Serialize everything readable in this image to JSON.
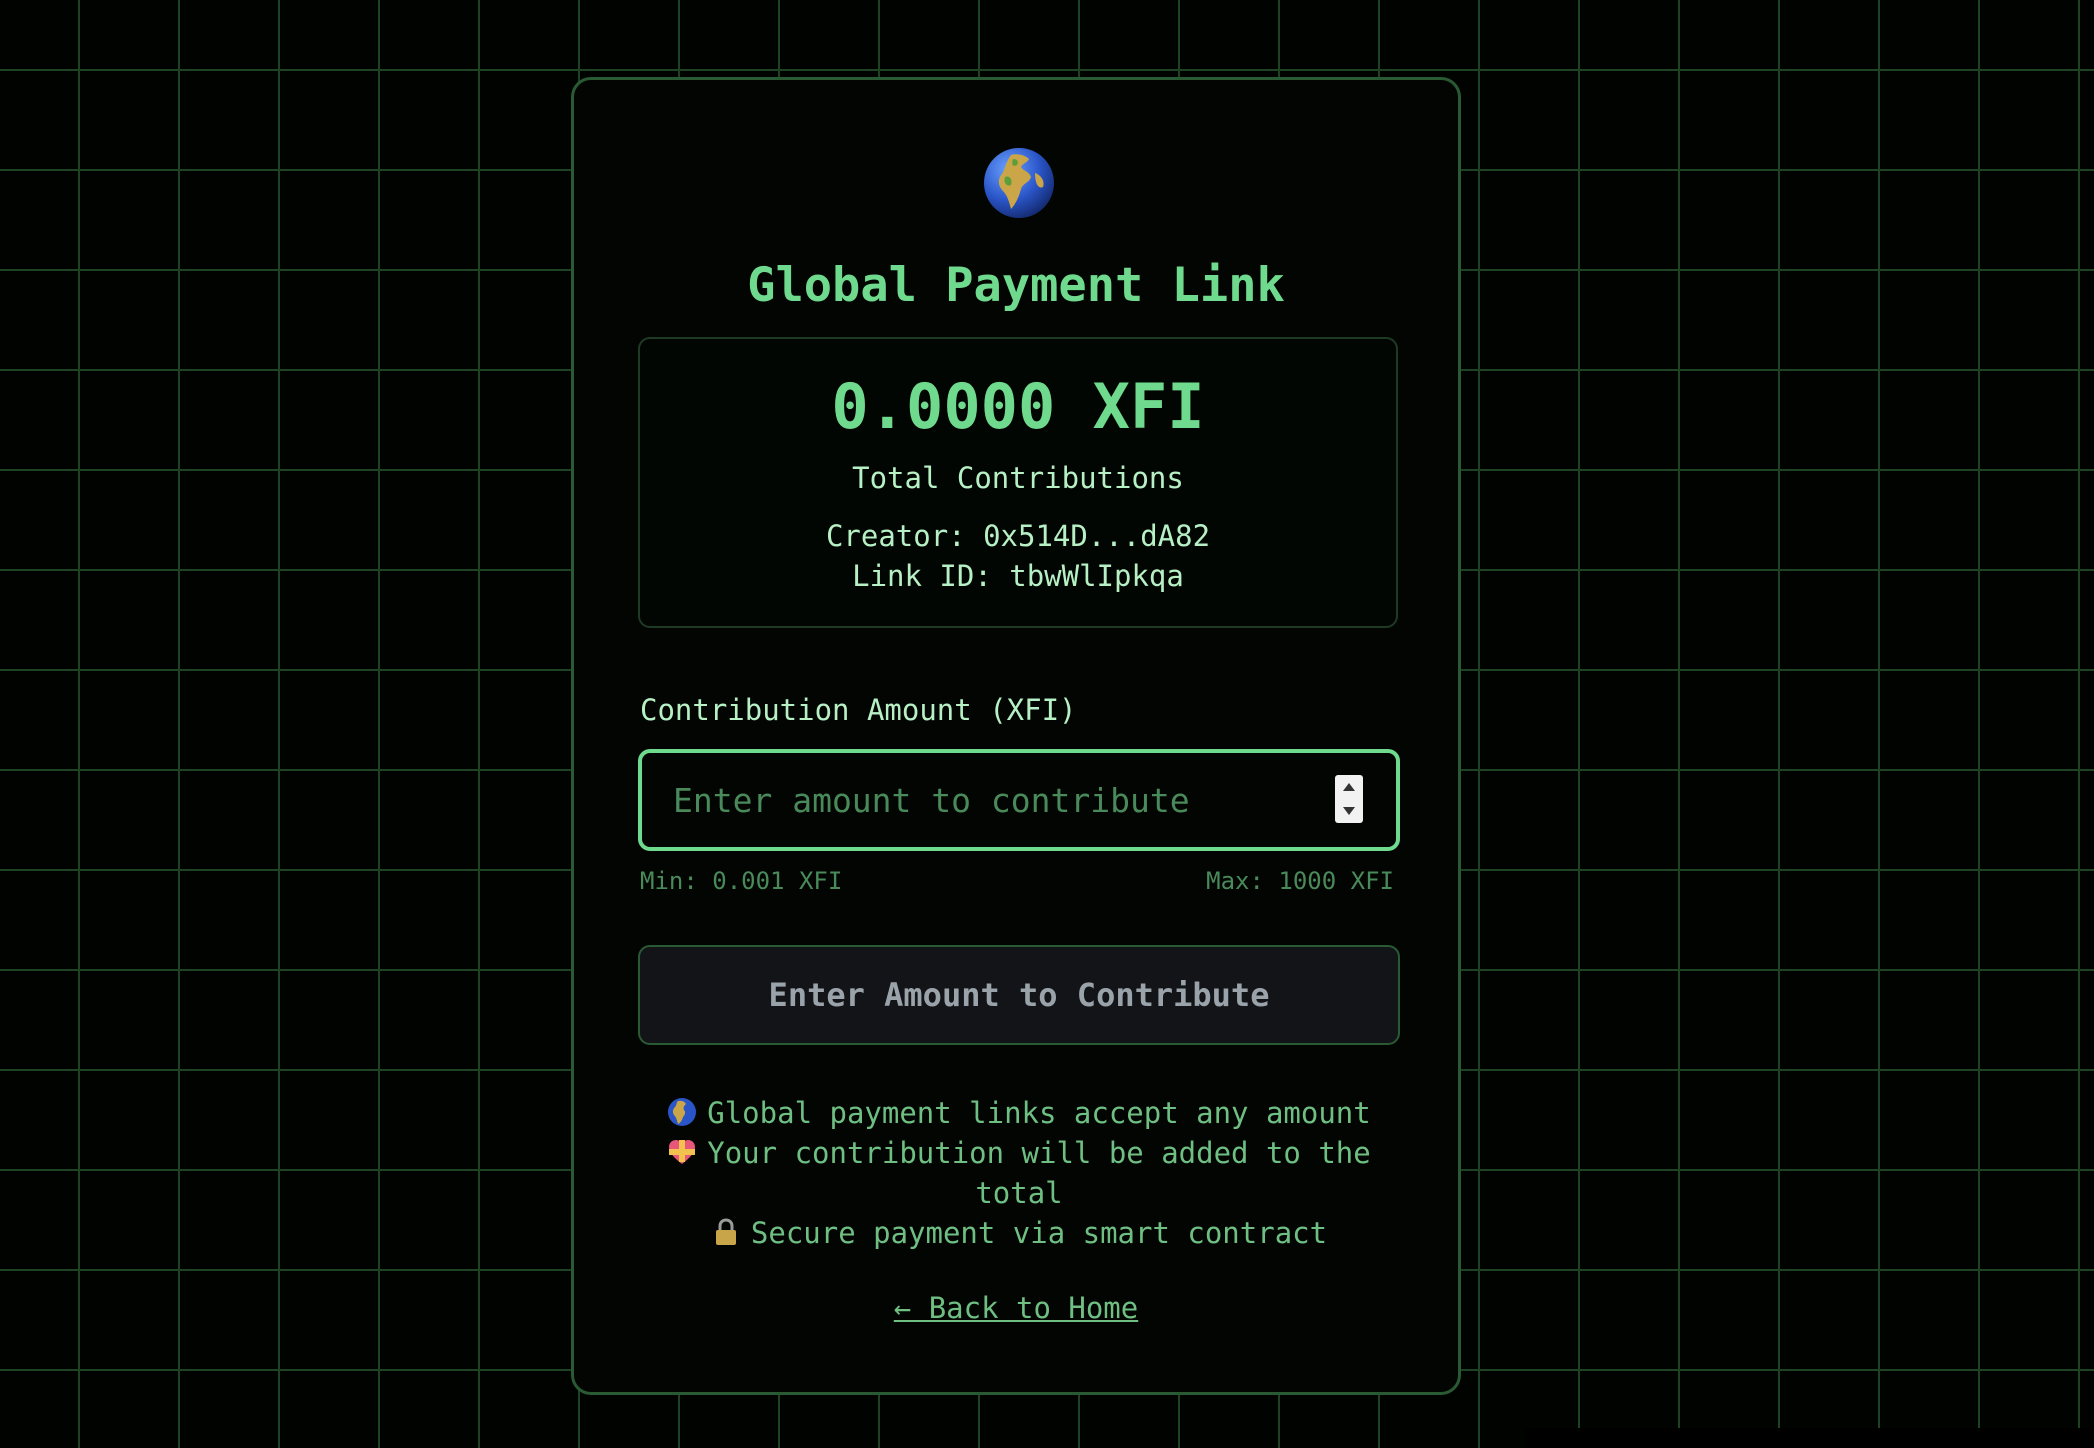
{
  "page": {
    "title": "Global Payment Link"
  },
  "stats": {
    "total_value": "0.0000 XFI",
    "total_label": "Total Contributions",
    "creator": "Creator: 0x514D...dA82",
    "link_id": "Link ID: tbwWlIpkqa"
  },
  "form": {
    "label": "Contribution Amount (XFI)",
    "placeholder": "Enter amount to contribute",
    "value": "",
    "min_hint": "Min: 0.001 XFI",
    "max_hint": "Max: 1000 XFI",
    "submit_label": "Enter Amount to Contribute"
  },
  "info": {
    "line1": "Global payment links accept any amount",
    "line2": "Your contribution will be added to the total",
    "line3": "Secure payment via smart contract"
  },
  "nav": {
    "back_label": "← Back to Home"
  },
  "icons": {
    "header": "globe-icon",
    "info1": "globe-icon",
    "info2": "heart-ribbon-icon",
    "info3": "lock-icon"
  },
  "colors": {
    "accent": "#6fd98d",
    "text_light": "#b6f0c4",
    "muted": "#4a8a5a",
    "border": "#2a5a33",
    "background": "#010301",
    "button_bg": "#121417",
    "button_text": "#9aa3aa"
  }
}
